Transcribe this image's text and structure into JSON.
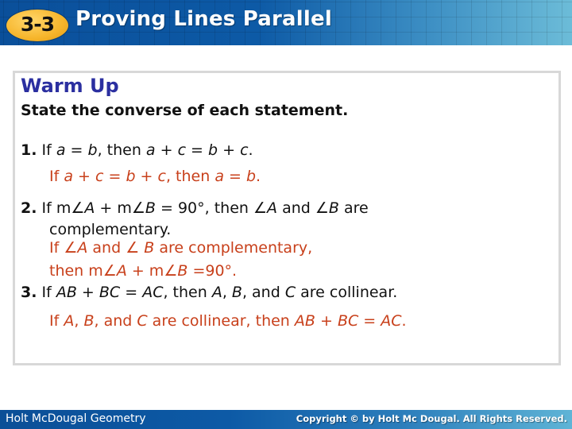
{
  "header": {
    "lesson_number": "3-3",
    "title": "Proving Lines Parallel"
  },
  "content": {
    "heading": "Warm Up",
    "instruction": "State the converse of each statement.",
    "items": [
      {
        "number": "1.",
        "statement": [
          "If ",
          "a",
          " = ",
          "b",
          ", then ",
          "a",
          " + ",
          "c",
          " = ",
          "b",
          " + ",
          "c",
          "."
        ],
        "answer": [
          "If ",
          "a",
          " + ",
          "c",
          " = ",
          "b",
          " + ",
          "c",
          ", then ",
          "a",
          " = ",
          "b",
          "."
        ]
      },
      {
        "number": "2.",
        "statement_line1": [
          "If m∠",
          "A",
          " + m∠",
          "B",
          " = 90°, then ∠",
          "A",
          " and ∠",
          "B",
          " are"
        ],
        "statement_line2": "complementary.",
        "answer_line1": [
          "If ∠",
          "A",
          " and ∠ ",
          "B",
          " are complementary,"
        ],
        "answer_line2": [
          "then m∠",
          "A",
          " + m∠",
          "B",
          " =90°."
        ]
      },
      {
        "number": "3.",
        "statement": [
          "If ",
          "AB",
          " + ",
          "BC",
          " = ",
          "AC",
          ", then ",
          "A",
          ", ",
          "B",
          ", and ",
          "C",
          " are collinear."
        ],
        "answer": [
          "If ",
          "A",
          ", ",
          "B",
          ", and ",
          "C",
          " are collinear, then ",
          "AB",
          " + ",
          "BC",
          " = ",
          "AC",
          "."
        ]
      }
    ]
  },
  "footer": {
    "left": "Holt McDougal Geometry",
    "right": "Copyright © by Holt Mc Dougal. All Rights Reserved."
  },
  "colors": {
    "heading": "#2b2fa0",
    "answer": "#c8401b",
    "header_bg": "#0d5aa6",
    "badge": "#f6b52b"
  }
}
